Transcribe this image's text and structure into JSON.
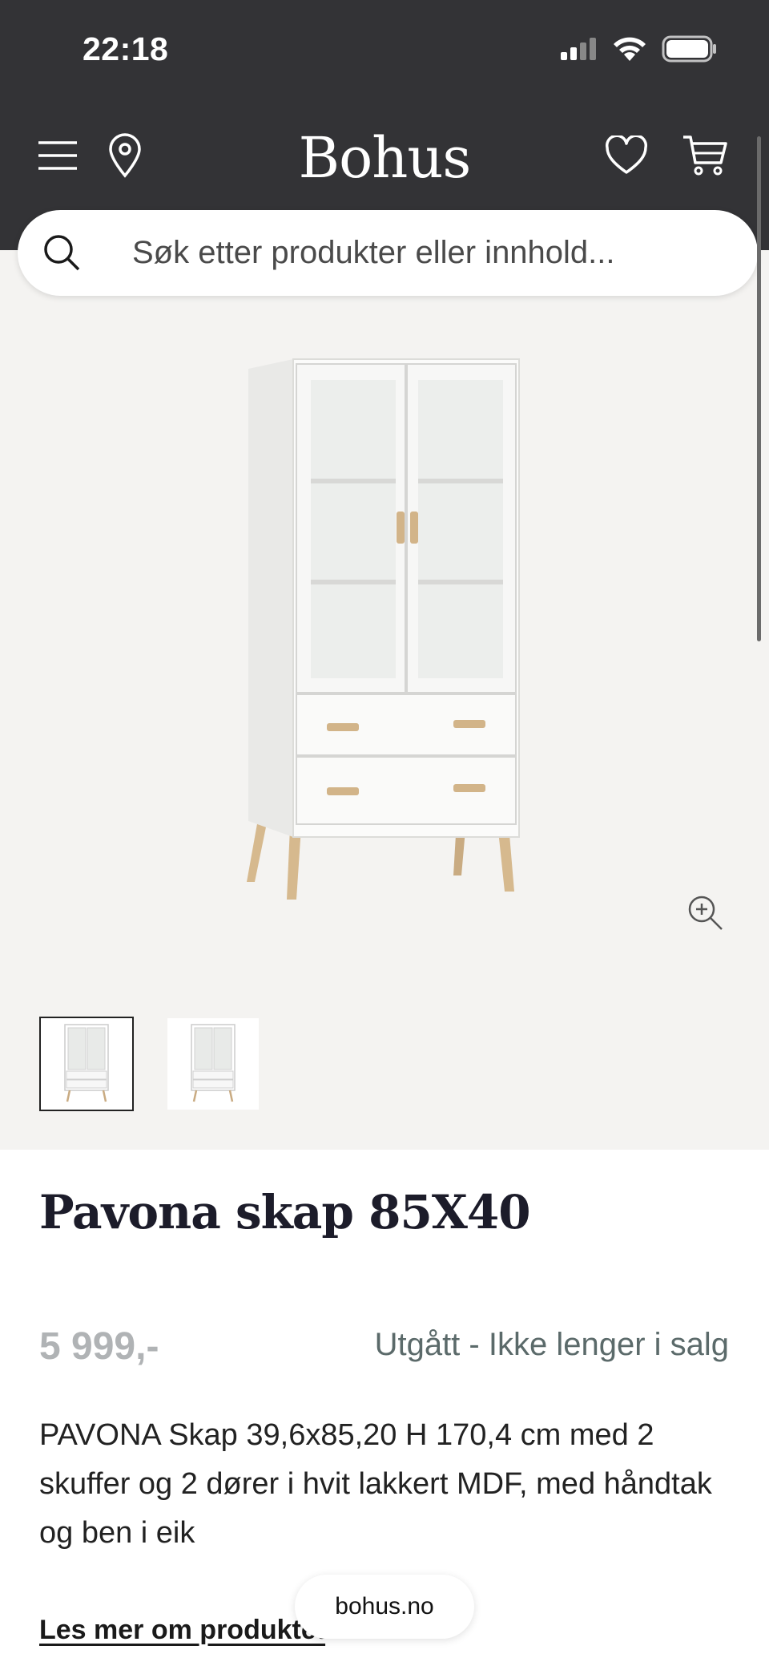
{
  "status_bar": {
    "time": "22:18"
  },
  "header": {
    "brand": "Bohus"
  },
  "search": {
    "placeholder": "Søk etter produkter eller innhold..."
  },
  "product": {
    "title": "Pavona skap 85X40",
    "price": "5 999,-",
    "availability": "Utgått - Ikke lenger i salg",
    "description": "PAVONA Skap 39,6x85,20 H 170,4 cm med 2 skuffer og 2 dører i hvit lakkert MDF, med håndtak og ben i eik",
    "read_more": "Les mer om produktet"
  },
  "browser": {
    "url": "bohus.no"
  },
  "colors": {
    "header_bg": "#333336",
    "gallery_bg": "#f4f3f1",
    "price_gray": "#b0b3b5"
  },
  "icons": [
    "menu-icon",
    "location-pin-icon",
    "heart-icon",
    "cart-icon",
    "search-icon",
    "zoom-in-icon"
  ]
}
